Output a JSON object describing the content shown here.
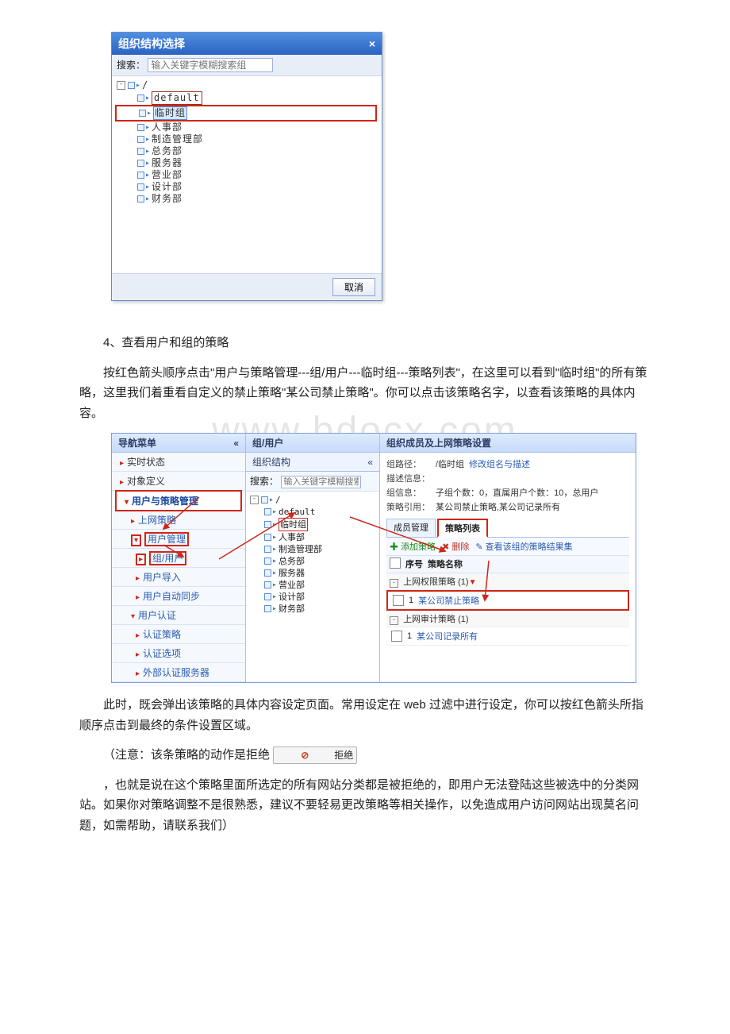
{
  "dialog1": {
    "title": "组织结构选择",
    "close_symbol": "×",
    "search_label": "搜索：",
    "search_placeholder": "输入关键字模糊搜索组",
    "root_label": "/",
    "nodes": [
      {
        "name": "default",
        "boxed": true
      },
      {
        "name": "临时组",
        "sel_red": true
      },
      {
        "name": "人事部"
      },
      {
        "name": "制造管理部"
      },
      {
        "name": "总务部"
      },
      {
        "name": "服务器"
      },
      {
        "name": "营业部"
      },
      {
        "name": "设计部"
      },
      {
        "name": "财务部"
      }
    ],
    "cancel_label": "取消"
  },
  "section4_title": "4、查看用户和组的策略",
  "para1": "按红色箭头顺序点击\"用户与策略管理---组/用户---临时组---策略列表\"，在这里可以看到\"临时组\"的所有策略，这里我们着重看自定义的禁止策略\"某公司禁止策略\"。你可以点击该策略名字，以查看该策略的具体内容。",
  "watermark": "www.bdocx.com",
  "panel2": {
    "nav_header": "导航菜单",
    "collapse_symbol": "«",
    "nav": {
      "realtime": "实时状态",
      "objdef": "对象定义",
      "userpolicy": "用户与策略管理",
      "netpolicy": "上网策略",
      "usermgmt": "用户管理",
      "group_user": "组/用户",
      "user_import": "用户导入",
      "user_sync": "用户自动同步",
      "userauth": "用户认证",
      "auth_policy": "认证策略",
      "auth_option": "认证选项",
      "ext_auth": "外部认证服务器"
    },
    "mid_header": "组/用户",
    "org_header": "组织结构",
    "search_label": "搜索：",
    "search_placeholder": "输入关键字模糊搜索组",
    "tree": {
      "root": "/",
      "items": [
        {
          "name": "default"
        },
        {
          "name": "临时组",
          "hl": true
        },
        {
          "name": "人事部"
        },
        {
          "name": "制造管理部"
        },
        {
          "name": "总务部"
        },
        {
          "name": "服务器"
        },
        {
          "name": "营业部"
        },
        {
          "name": "设计部"
        },
        {
          "name": "财务部"
        }
      ]
    },
    "right_header": "组织成员及上网策略设置",
    "info": {
      "path_lbl": "组路径：",
      "path_val": "/临时组",
      "path_act": "修改组名与描述",
      "desc_lbl": "描述信息：",
      "grp_lbl": "组信息：",
      "grp_val": "子组个数：0，直属用户个数：10，总用户",
      "ref_lbl": "策略引用：",
      "ref_val": "某公司禁止策略,某公司记录所有"
    },
    "tabs": {
      "member": "成员管理",
      "policy": "策略列表"
    },
    "toolbar": {
      "add": "添加策略",
      "del": "删除",
      "view": "查看该组的策略结果集"
    },
    "cols": {
      "c1": "序号",
      "c2": "策略名称"
    },
    "groups": {
      "g1_label": "上网权限策略  (1)",
      "g1_row_no": "1",
      "g1_row_name": "某公司禁止策略",
      "g2_label": "上网审计策略  (1)",
      "g2_row_no": "1",
      "g2_row_name": "某公司记录所有"
    }
  },
  "para2": "此时，既会弹出该策略的具体内容设定页面。常用设定在 web 过滤中进行设定，你可以按红色箭头所指顺序点击到最终的条件设置区域。",
  "para3a": "（注意：该条策略的动作是拒绝",
  "reject_label": "拒绝",
  "para4": "，也就是说在这个策略里面所选定的所有网站分类都是被拒绝的，即用户无法登陆这些被选中的分类网站。如果你对策略调整不是很熟悉，建议不要轻易更改策略等相关操作，以免造成用户访问网站出现莫名问题，如需帮助，请联系我们）"
}
